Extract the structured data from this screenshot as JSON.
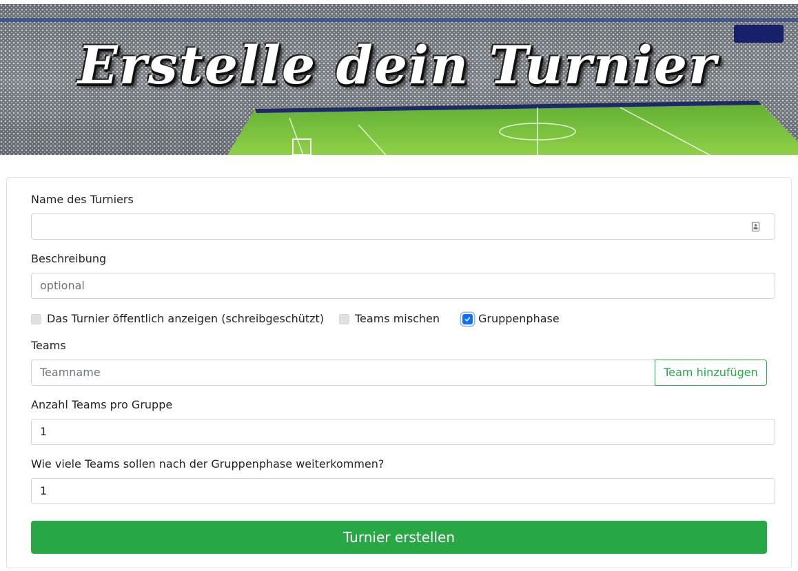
{
  "banner": {
    "title": "Erstelle dein Turnier"
  },
  "form": {
    "name_label": "Name des Turniers",
    "name_value": "",
    "description_label": "Beschreibung",
    "description_placeholder": "optional",
    "checkboxes": [
      {
        "label": "Das Turnier öffentlich anzeigen (schreibgeschützt)",
        "checked": false
      },
      {
        "label": "Teams mischen",
        "checked": false
      },
      {
        "label": "Gruppenphase",
        "checked": true
      }
    ],
    "teams_label": "Teams",
    "team_placeholder": "Teamname",
    "add_team_button": "Team hinzufügen",
    "teams_per_group_label": "Anzahl Teams pro Gruppe",
    "teams_per_group_value": "1",
    "advance_label": "Wie viele Teams sollen nach der Gruppenphase weiterkommen?",
    "advance_value": "1",
    "submit_button": "Turnier erstellen"
  },
  "colors": {
    "primary_green": "#28a745",
    "checkbox_blue": "#0d6efd"
  }
}
